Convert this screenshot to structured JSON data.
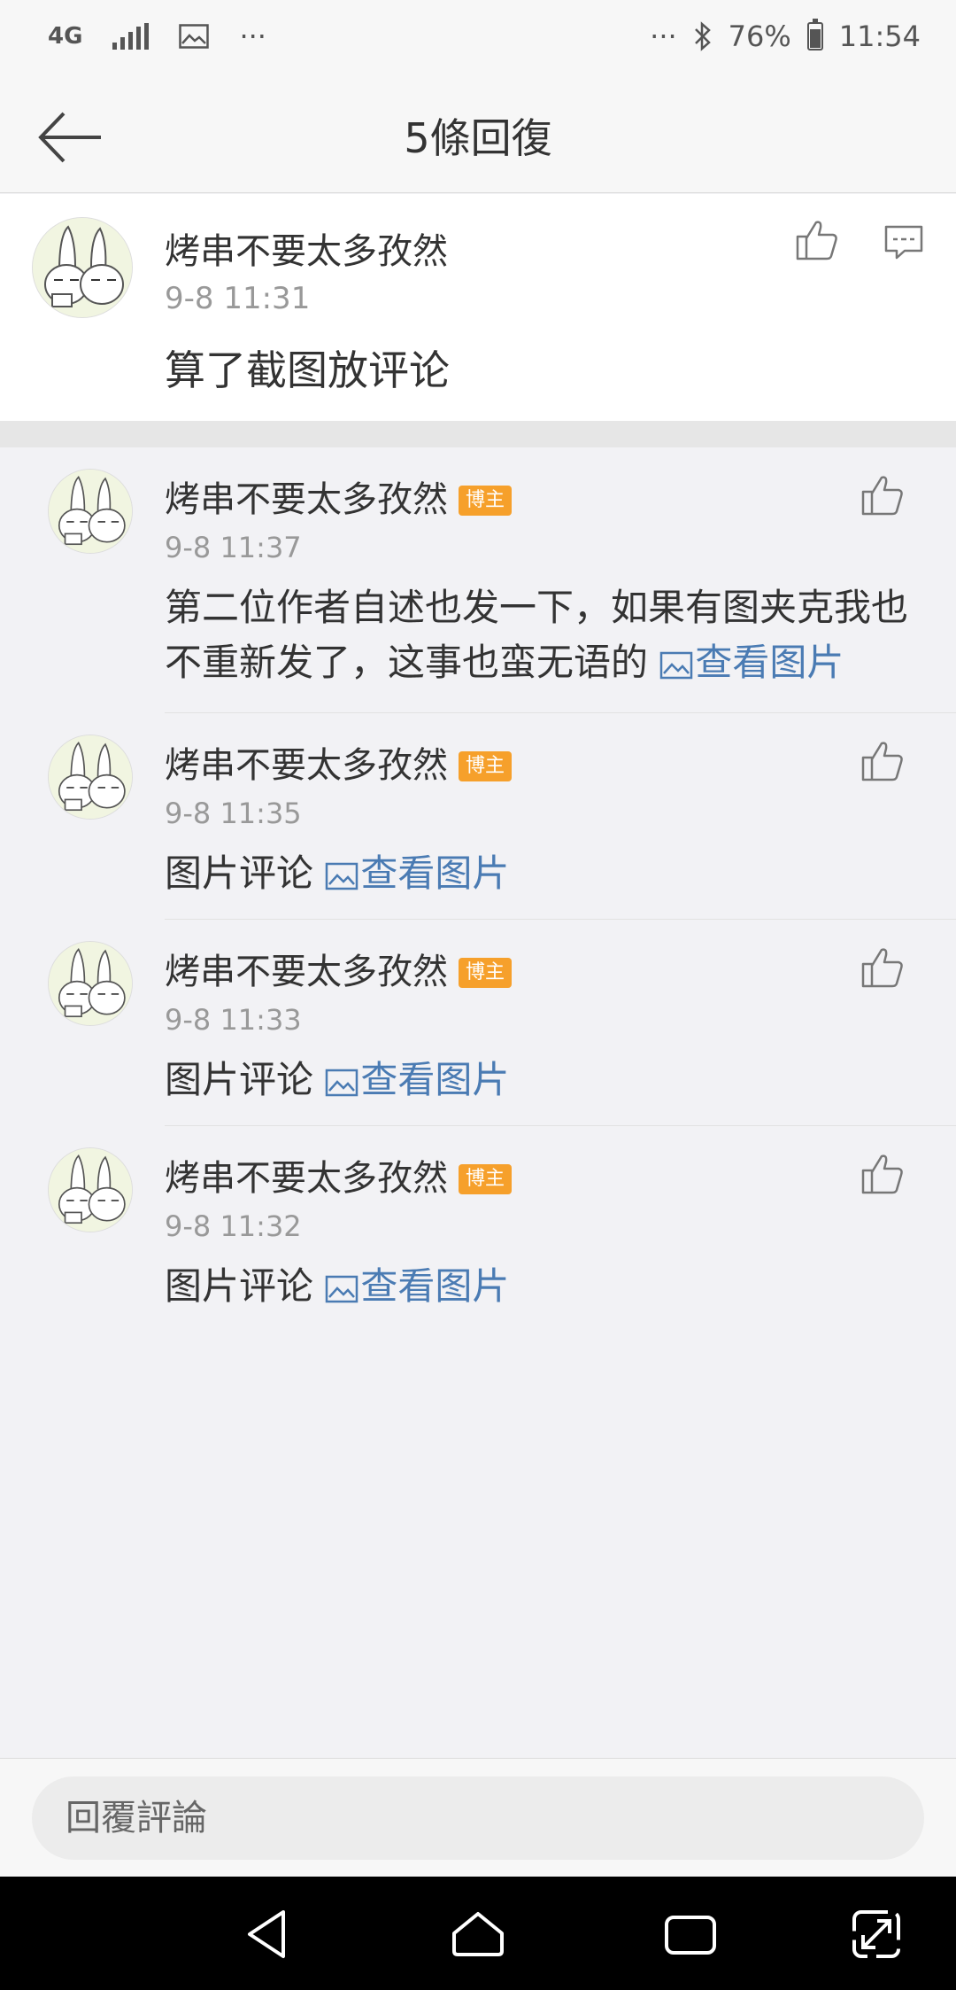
{
  "status_bar": {
    "network": "4G",
    "more": "···",
    "more_right": "···",
    "battery": "76%",
    "time": "11:54"
  },
  "header": {
    "title": "5條回復"
  },
  "root_comment": {
    "username": "烤串不要太多孜然",
    "time": "9-8 11:31",
    "text": "算了截图放评论"
  },
  "replies": [
    {
      "username": "烤串不要太多孜然",
      "badge": "博主",
      "time": "9-8 11:37",
      "text": "第二位作者自述也发一下，如果有图夹克我也不重新发了，这事也蛮无语的",
      "link": "查看图片"
    },
    {
      "username": "烤串不要太多孜然",
      "badge": "博主",
      "time": "9-8 11:35",
      "text": "图片评论",
      "link": "查看图片"
    },
    {
      "username": "烤串不要太多孜然",
      "badge": "博主",
      "time": "9-8 11:33",
      "text": "图片评论",
      "link": "查看图片"
    },
    {
      "username": "烤串不要太多孜然",
      "badge": "博主",
      "time": "9-8 11:32",
      "text": "图片评论",
      "link": "查看图片"
    }
  ],
  "reply_bar": {
    "placeholder": "回覆評論"
  },
  "colors": {
    "badge": "#f6a02b",
    "link": "#4a7bb3",
    "background": "#f2f2f5"
  }
}
